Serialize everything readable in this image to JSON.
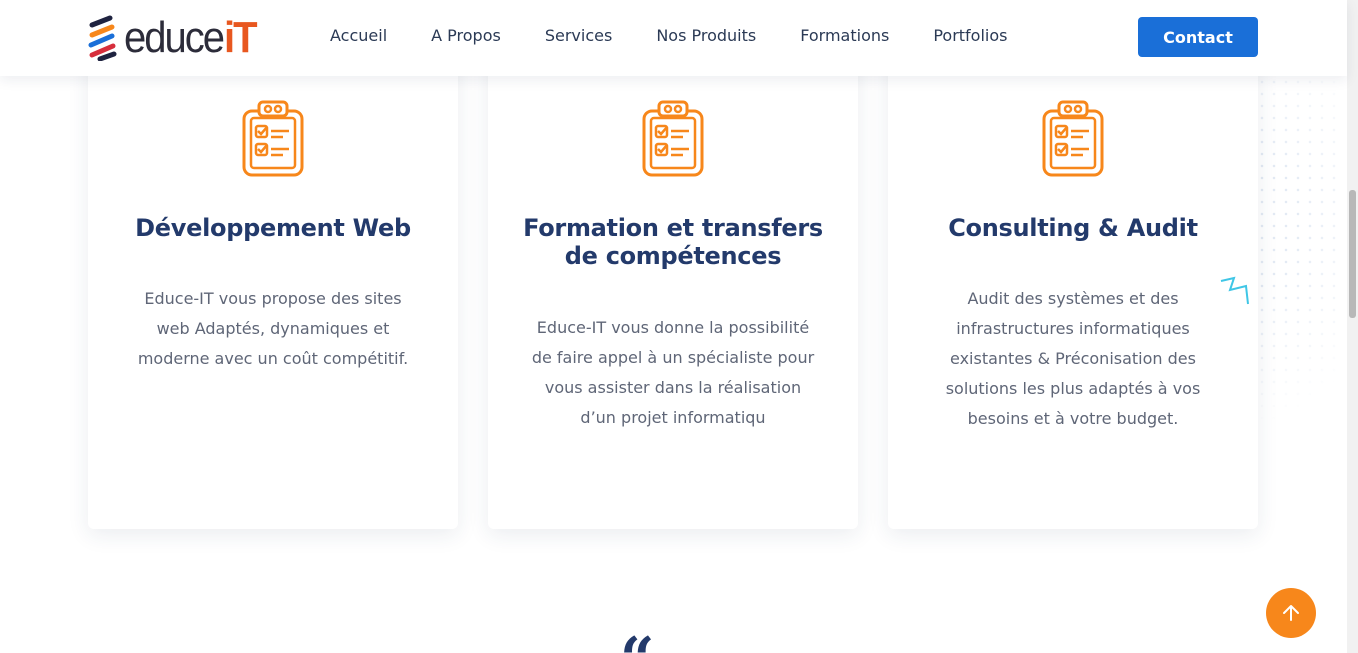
{
  "header": {
    "logo_text": "educe",
    "logo_it": "iT",
    "nav": [
      "Accueil",
      "A Propos",
      "Services",
      "Nos Produits",
      "Formations",
      "Portfolios"
    ],
    "contact_label": "Contact"
  },
  "cards": [
    {
      "icon": "clipboard-checklist-icon",
      "title": "Développement Web",
      "lines": [
        "Educe-IT vous propose des sites",
        "web Adaptés, dynamiques et",
        "moderne avec un coût compétitif."
      ]
    },
    {
      "icon": "clipboard-checklist-icon",
      "title_lines": [
        "Formation et transfers",
        "de compétences"
      ],
      "lines": [
        "Educe-IT vous donne la possibilité",
        "de faire appel à un spécialiste pour",
        "vous assister dans la réalisation",
        "d’un projet informatiqu"
      ]
    },
    {
      "icon": "clipboard-checklist-icon",
      "title": "Consulting & Audit",
      "lines": [
        "Audit des systèmes et des",
        "infrastructures informatiques",
        "existantes & Préconisation des",
        "solutions les plus adaptés à vos",
        "besoins et à votre budget."
      ]
    }
  ],
  "quote_glyph": "“",
  "colors": {
    "accent_orange": "#f7871b",
    "brand_blue": "#1a6fd8",
    "title_navy": "#233a6b",
    "body_gray": "#5f6677",
    "squiggle_cyan": "#3fc6e6"
  }
}
